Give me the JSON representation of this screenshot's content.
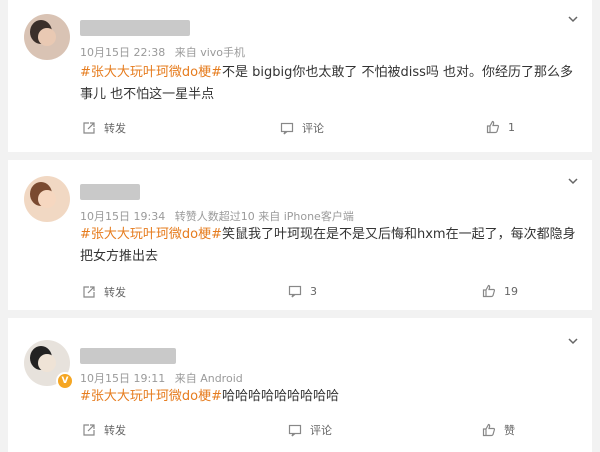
{
  "comments": [
    {
      "date": "10月15日 22:38",
      "source": "来自 vivo手机",
      "topic": "#张大大玩叶珂微do梗#",
      "text": "不是 bigbig你也太敢了 不怕被diss吗 也对。你经历了那么多事儿 也不怕这一星半点",
      "repost_label": "转发",
      "comment_label": "评论",
      "like_count": "1"
    },
    {
      "date": "10月15日 19:34",
      "source": "转赞人数超过10  来自 iPhone客户端",
      "topic": "#张大大玩叶珂微do梗#",
      "text": "笑鼠我了叶珂现在是不是又后悔和hxm在一起了，每次都隐身把女方推出去",
      "repost_label": "转发",
      "comment_count": "3",
      "like_count": "19"
    },
    {
      "date": "10月15日 19:11",
      "source": "来自 Android",
      "topic": "#张大大玩叶珂微do梗#",
      "text": "哈哈哈哈哈哈哈哈哈",
      "repost_label": "转发",
      "comment_label": "评论",
      "like_label": "赞"
    }
  ],
  "icons": {
    "repost": "repost-icon",
    "comment": "comment-icon",
    "like": "thumbs-up-icon",
    "more": "chevron-down-icon",
    "verified": "verified-badge-icon"
  },
  "colors": {
    "topic": "#e67c1e",
    "meta": "#9a9a9a",
    "badge": "#f5a623"
  }
}
